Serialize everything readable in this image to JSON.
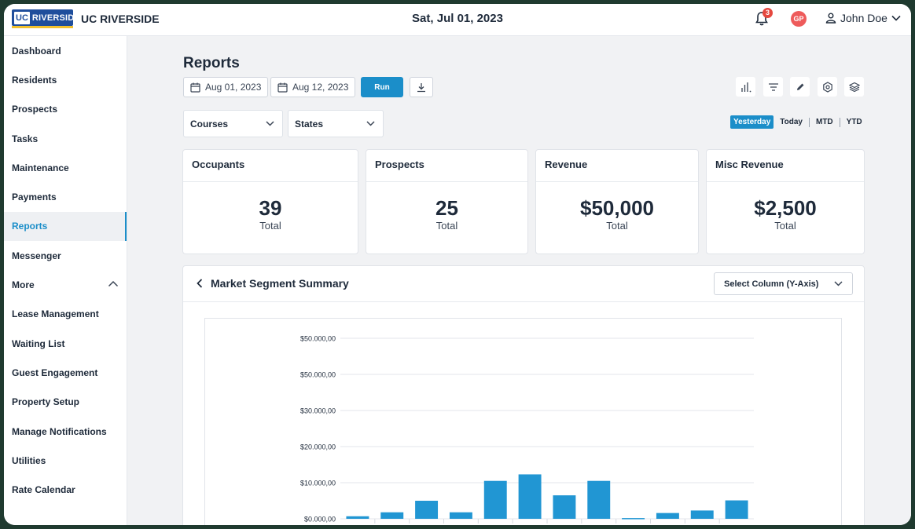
{
  "header": {
    "logo_text": "UC RIVERSIDE",
    "logo_uc": "UC",
    "logo_rv": "RIVERSIDE",
    "brand": "UC RIVERSIDE",
    "date": "Sat, Jul 01, 2023",
    "notification_count": "3",
    "avatar_initials": "GP",
    "user_name": "John Doe"
  },
  "sidebar": {
    "items": [
      {
        "label": "Dashboard"
      },
      {
        "label": "Residents"
      },
      {
        "label": "Prospects"
      },
      {
        "label": "Tasks"
      },
      {
        "label": "Maintenance"
      },
      {
        "label": "Payments"
      },
      {
        "label": "Reports",
        "active": true
      },
      {
        "label": "Messenger"
      },
      {
        "label": "More"
      },
      {
        "label": "Lease Management"
      },
      {
        "label": "Waiting List"
      },
      {
        "label": "Guest Engagement"
      },
      {
        "label": "Property Setup"
      },
      {
        "label": "Manage Notifications"
      },
      {
        "label": "Utilities"
      },
      {
        "label": "Rate Calendar"
      }
    ]
  },
  "page": {
    "title": "Reports",
    "start_date": "Aug 01, 2023",
    "end_date": "Aug 12, 2023",
    "run_label": "Run",
    "filters": {
      "courses": "Courses",
      "states": "States"
    },
    "periods": [
      "Yesterday",
      "Today",
      "MTD",
      "YTD"
    ],
    "active_period": "Yesterday",
    "toolbar_icons": [
      "bar-chart-icon",
      "filter-icon",
      "pencil-icon",
      "settings-icon",
      "layers-icon"
    ]
  },
  "cards": [
    {
      "title": "Occupants",
      "value": "39",
      "sub": "Total"
    },
    {
      "title": "Prospects",
      "value": "25",
      "sub": "Total"
    },
    {
      "title": "Revenue",
      "value": "$50,000",
      "sub": "Total"
    },
    {
      "title": "Misc Revenue",
      "value": "$2,500",
      "sub": "Total"
    }
  ],
  "panel": {
    "title": "Market Segment Summary",
    "select_placeholder": "Select Column (Y-Axis)"
  },
  "colors": {
    "accent": "#1b8ec9",
    "bar": "#2196d3",
    "badge": "#e5483f",
    "avatar": "#ee5b5b"
  },
  "chart_data": {
    "type": "bar",
    "y_tick_labels": [
      "$50.000,00",
      "$50.000,00",
      "$30.000,00",
      "$20.000,00",
      "$10.000,00",
      "$0.000,00"
    ],
    "y_tick_values": [
      50000,
      40000,
      30000,
      20000,
      10000,
      0
    ],
    "ylim": [
      0,
      50000
    ],
    "values": [
      700,
      1800,
      5000,
      1800,
      10500,
      12300,
      6500,
      10500,
      200,
      1600,
      2300,
      5100
    ],
    "grid": true
  }
}
